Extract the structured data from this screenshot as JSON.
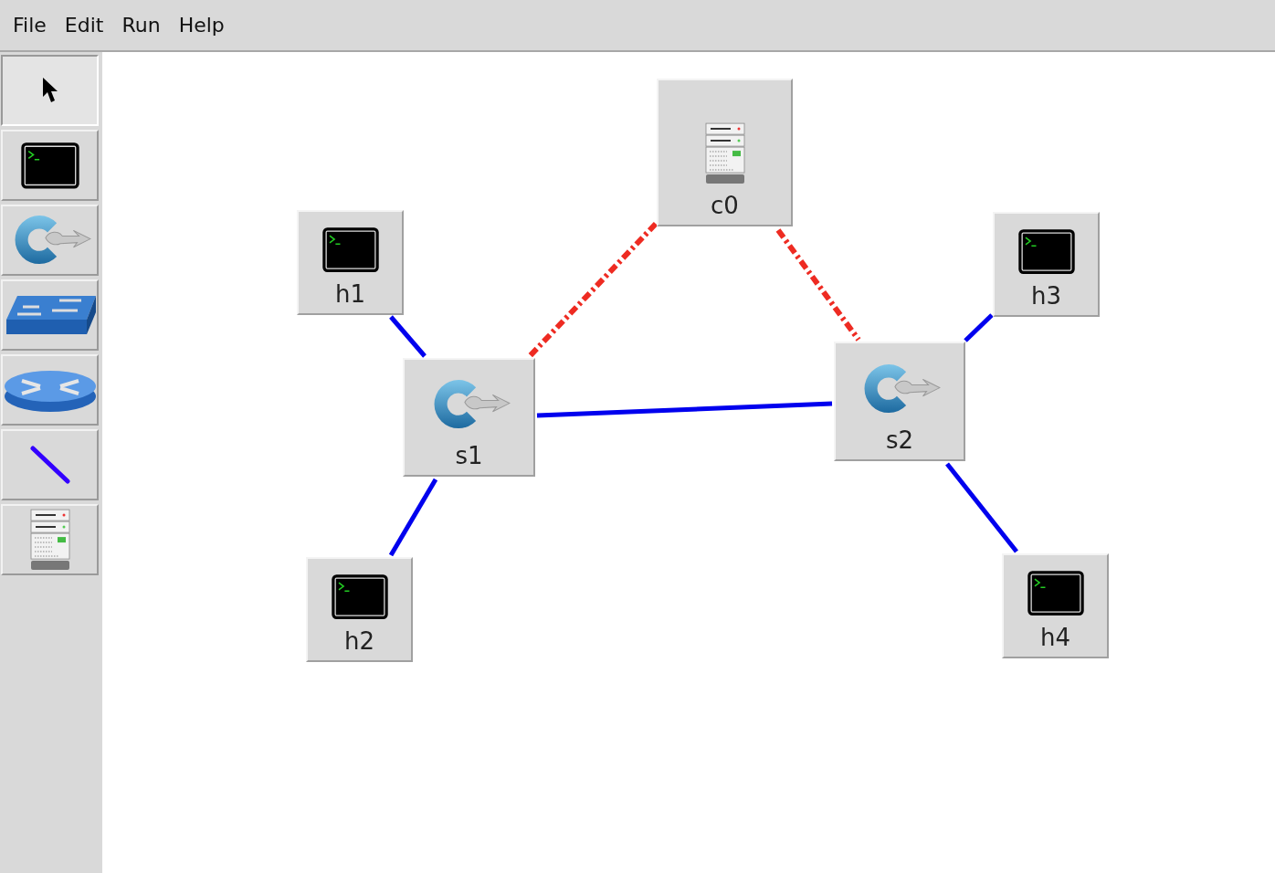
{
  "menu": [
    "File",
    "Edit",
    "Run",
    "Help"
  ],
  "tools": [
    {
      "kind": "select",
      "selected": true
    },
    {
      "kind": "host",
      "selected": false
    },
    {
      "kind": "switch",
      "selected": false
    },
    {
      "kind": "legacy-switch",
      "selected": false
    },
    {
      "kind": "router",
      "selected": false
    },
    {
      "kind": "link",
      "selected": false
    },
    {
      "kind": "controller",
      "selected": false
    }
  ],
  "nodes": [
    {
      "kind": "controller",
      "label": "c0"
    },
    {
      "kind": "host",
      "label": "h1"
    },
    {
      "kind": "host",
      "label": "h3"
    },
    {
      "kind": "switch",
      "label": "s1"
    },
    {
      "kind": "switch",
      "label": "s2"
    },
    {
      "kind": "host",
      "label": "h2"
    },
    {
      "kind": "host",
      "label": "h4"
    }
  ],
  "links": [
    {
      "kind": "data"
    },
    {
      "kind": "data"
    },
    {
      "kind": "data"
    },
    {
      "kind": "data"
    },
    {
      "kind": "data"
    },
    {
      "kind": "control"
    },
    {
      "kind": "control"
    }
  ]
}
